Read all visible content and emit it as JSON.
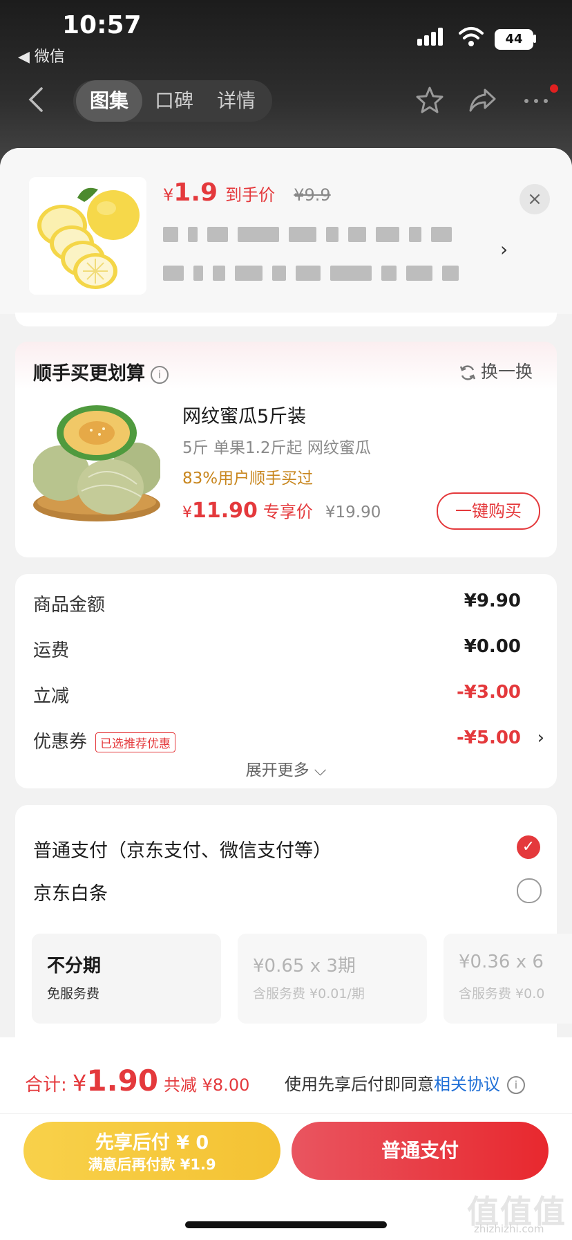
{
  "status_bar": {
    "time": "10:57",
    "back_app": "◀ 微信",
    "battery": "44"
  },
  "nav": {
    "tabs": [
      {
        "label": "图集",
        "active": true
      },
      {
        "label": "口碑"
      },
      {
        "label": "详情"
      }
    ]
  },
  "product": {
    "price_symbol": "¥",
    "price_value": "1.9",
    "price_label": "到手价",
    "original_price": "¥9.9",
    "close_icon": "×"
  },
  "upsell": {
    "title": "顺手买更划算",
    "refresh_label": "换一换",
    "item_name": "网纹蜜瓜5斤装",
    "spec": "5斤 单果1.2斤起 网纹蜜瓜",
    "rate": "83%用户顺手买过",
    "price_symbol": "¥",
    "price_value": "11.90",
    "price_tag": "专享价",
    "original_price": "¥19.90",
    "buy_label": "一键购买"
  },
  "summary": {
    "rows": [
      {
        "label": "商品金额",
        "value": "¥9.90"
      },
      {
        "label": "运费",
        "value": "¥0.00"
      },
      {
        "label": "立减",
        "value": "-¥3.00"
      },
      {
        "label": "优惠券",
        "tag": "已选推荐优惠",
        "value": "-¥5.00"
      }
    ],
    "expand_label": "展开更多 ⌵"
  },
  "payment": {
    "options": [
      {
        "label": "普通支付（京东支付、微信支付等）",
        "selected": true
      },
      {
        "label": "京东白条",
        "selected": false
      }
    ],
    "plans": [
      {
        "title": "不分期",
        "sub": "免服务费"
      },
      {
        "title": "¥0.65 x 3期",
        "sub": "含服务费 ¥0.01/期"
      },
      {
        "title": "¥0.36 x 6",
        "sub": "含服务费 ¥0.0"
      }
    ]
  },
  "bottom": {
    "total_label": "合计: ",
    "total_symbol": "¥",
    "total_value": "1.90",
    "saving": "共减 ¥8.00",
    "agree_text": "使用先享后付即同意",
    "agree_link": "相关协议",
    "later_title": "先享后付 ¥ 0",
    "later_sub": "满意后再付款 ¥1.9",
    "pay_label": "普通支付"
  },
  "watermark": {
    "main": "值值值",
    "sub": "zhizhizhi.com"
  },
  "colors": {
    "accent": "#e4393c",
    "gold": "#f4c233",
    "link": "#1f6fd6"
  }
}
